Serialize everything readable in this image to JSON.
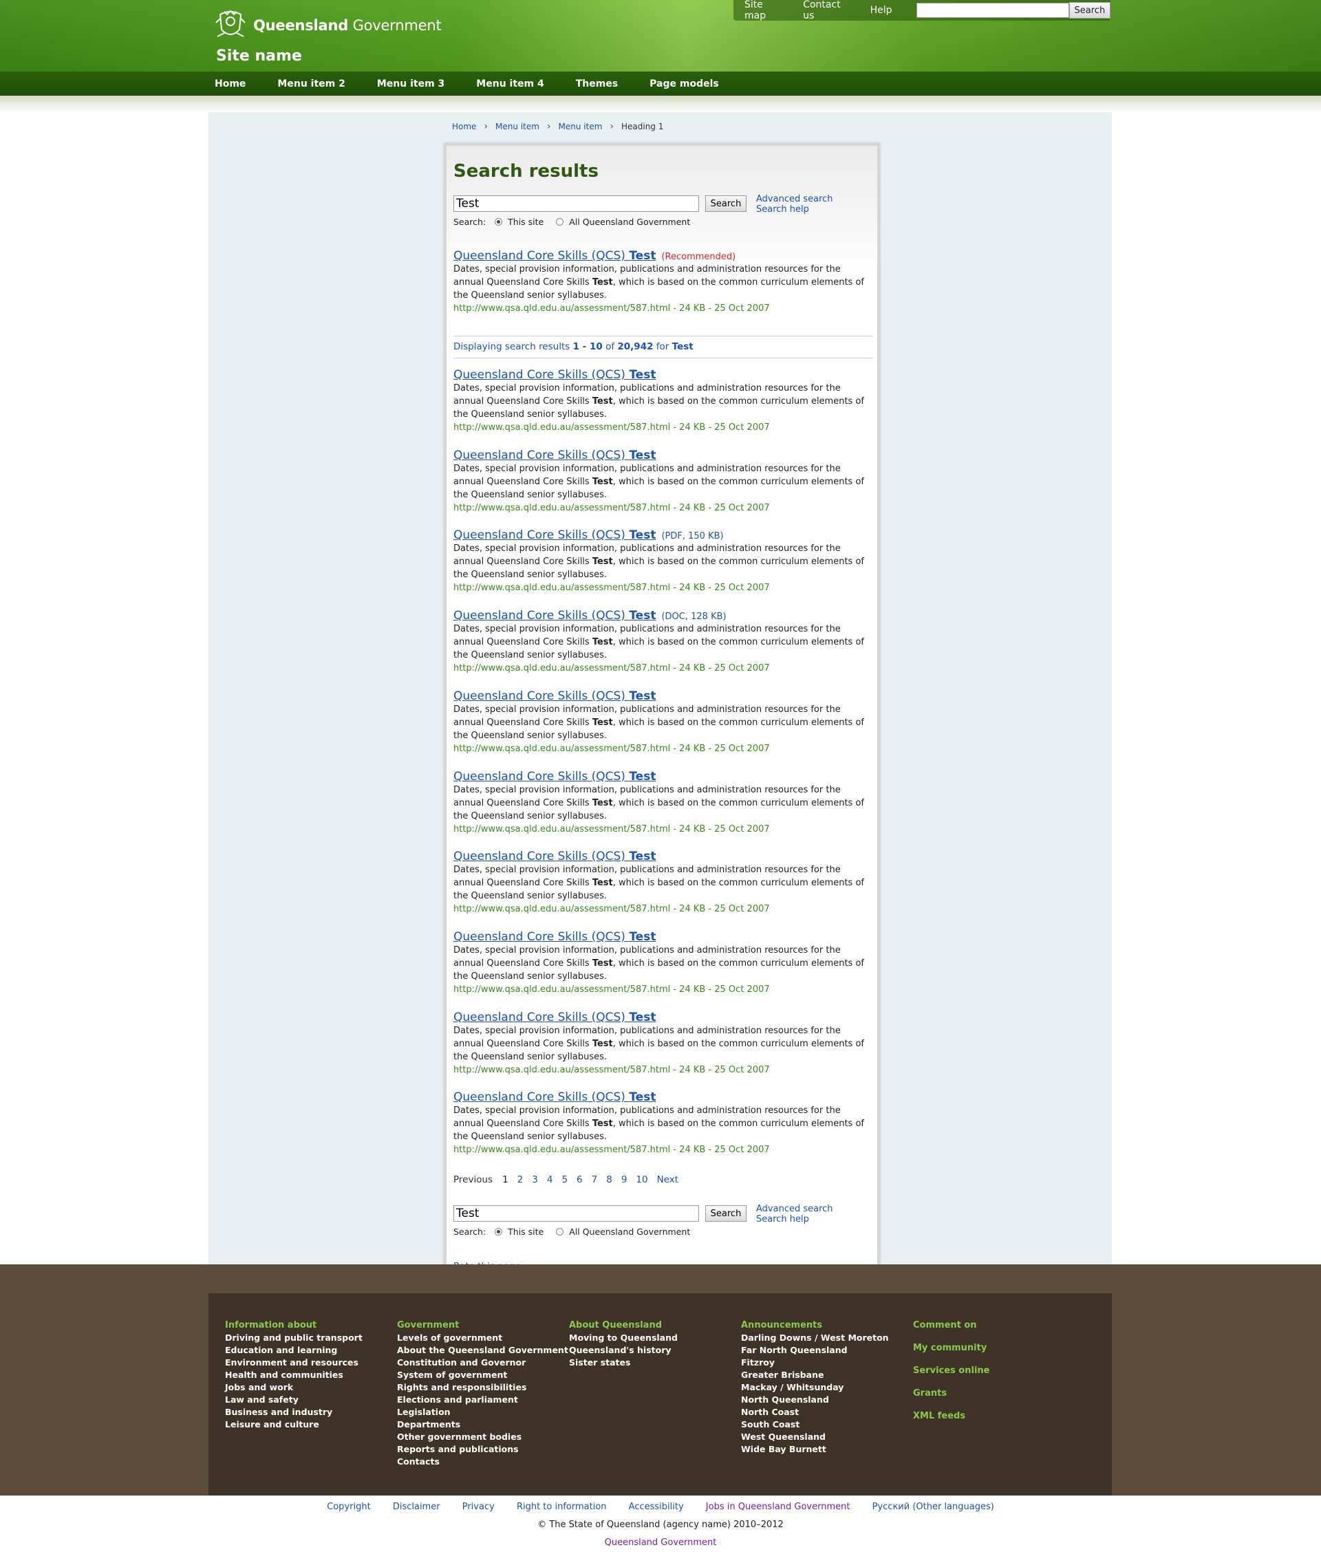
{
  "header": {
    "brand_bold": "Queensland",
    "brand_rest": " Government",
    "site_name": "Site name",
    "utility_links": [
      "Site map",
      "Contact us",
      "Help"
    ],
    "search_button": "Search",
    "search_value": ""
  },
  "nav": [
    "Home",
    "Menu item 2",
    "Menu item 3",
    "Menu item 4",
    "Themes",
    "Page models"
  ],
  "breadcrumb": [
    "Home",
    "Menu item",
    "Menu item",
    "Heading 1"
  ],
  "main": {
    "title": "Search results",
    "search": {
      "value": "Test",
      "button": "Search",
      "advanced": "Advanced search",
      "help": "Search help",
      "scope_label": "Search:",
      "scope_options": [
        "This site",
        "All Queensland Government"
      ],
      "selected_scope": "This site"
    },
    "recommended": {
      "title": "Queensland Core Skills (QCS) ",
      "title_bold": "Test",
      "tag": "(Recommended)",
      "desc_1": "Dates, special provision information, publications and administration resources for the annual Queensland Core Skills ",
      "desc_bold": "Test",
      "desc_2": ", which is based on the common curriculum elements of the Queensland senior syllabuses.",
      "url": "http://www.qsa.qld.edu.au/assessment/587.html - 24 KB - 25 Oct 2007"
    },
    "display_line": {
      "prefix": "Displaying search results ",
      "range": "1 - 10",
      "of": " of ",
      "total": "20,942",
      "for": " for ",
      "query": "Test"
    },
    "results": [
      {
        "title": "Queensland Core Skills (QCS) ",
        "title_bold": "Test",
        "tag": "",
        "desc_1": "Dates, special provision information, publications and administration resources for the annual Queensland Core Skills ",
        "desc_bold": "Test",
        "desc_2": ", which is based on the common curriculum elements of the Queensland senior syllabuses.",
        "url": "http://www.qsa.qld.edu.au/assessment/587.html - 24 KB - 25 Oct 2007"
      },
      {
        "title": "Queensland Core Skills (QCS) ",
        "title_bold": "Test",
        "tag": "",
        "desc_1": "Dates, special provision information, publications and administration resources for the annual Queensland Core Skills ",
        "desc_bold": "Test",
        "desc_2": ", which is based on the common curriculum elements of the Queensland senior syllabuses.",
        "url": "http://www.qsa.qld.edu.au/assessment/587.html - 24 KB - 25 Oct 2007"
      },
      {
        "title": "Queensland Core Skills (QCS) ",
        "title_bold": "Test",
        "tag": "(PDF, 150 KB)",
        "desc_1": "Dates, special provision information, publications and administration resources for the annual Queensland Core Skills ",
        "desc_bold": "Test",
        "desc_2": ", which is based on the common curriculum elements of the Queensland senior syllabuses.",
        "url": "http://www.qsa.qld.edu.au/assessment/587.html - 24 KB - 25 Oct 2007"
      },
      {
        "title": "Queensland Core Skills (QCS) ",
        "title_bold": "Test",
        "tag": "(DOC, 128 KB)",
        "desc_1": "Dates, special provision information, publications and administration resources for the annual Queensland Core Skills ",
        "desc_bold": "Test",
        "desc_2": ", which is based on the common curriculum elements of the Queensland senior syllabuses.",
        "url": "http://www.qsa.qld.edu.au/assessment/587.html - 24 KB - 25 Oct 2007"
      },
      {
        "title": "Queensland Core Skills (QCS) ",
        "title_bold": "Test",
        "tag": "",
        "desc_1": "Dates, special provision information, publications and administration resources for the annual Queensland Core Skills ",
        "desc_bold": "Test",
        "desc_2": ", which is based on the common curriculum elements of the Queensland senior syllabuses.",
        "url": "http://www.qsa.qld.edu.au/assessment/587.html - 24 KB - 25 Oct 2007"
      },
      {
        "title": "Queensland Core Skills (QCS) ",
        "title_bold": "Test",
        "tag": "",
        "desc_1": "Dates, special provision information, publications and administration resources for the annual Queensland Core Skills ",
        "desc_bold": "Test",
        "desc_2": ", which is based on the common curriculum elements of the Queensland senior syllabuses.",
        "url": "http://www.qsa.qld.edu.au/assessment/587.html - 24 KB - 25 Oct 2007"
      },
      {
        "title": "Queensland Core Skills (QCS) ",
        "title_bold": "Test",
        "tag": "",
        "desc_1": "Dates, special provision information, publications and administration resources for the annual Queensland Core Skills ",
        "desc_bold": "Test",
        "desc_2": ", which is based on the common curriculum elements of the Queensland senior syllabuses.",
        "url": "http://www.qsa.qld.edu.au/assessment/587.html - 24 KB - 25 Oct 2007"
      },
      {
        "title": "Queensland Core Skills (QCS) ",
        "title_bold": "Test",
        "tag": "",
        "desc_1": "Dates, special provision information, publications and administration resources for the annual Queensland Core Skills ",
        "desc_bold": "Test",
        "desc_2": ", which is based on the common curriculum elements of the Queensland senior syllabuses.",
        "url": "http://www.qsa.qld.edu.au/assessment/587.html - 24 KB - 25 Oct 2007"
      },
      {
        "title": "Queensland Core Skills (QCS) ",
        "title_bold": "Test",
        "tag": "",
        "desc_1": "Dates, special provision information, publications and administration resources for the annual Queensland Core Skills ",
        "desc_bold": "Test",
        "desc_2": ", which is based on the common curriculum elements of the Queensland senior syllabuses.",
        "url": "http://www.qsa.qld.edu.au/assessment/587.html - 24 KB - 25 Oct 2007"
      },
      {
        "title": "Queensland Core Skills (QCS) ",
        "title_bold": "Test",
        "tag": "",
        "desc_1": "Dates, special provision information, publications and administration resources for the annual Queensland Core Skills ",
        "desc_bold": "Test",
        "desc_2": ", which is based on the common curriculum elements of the Queensland senior syllabuses.",
        "url": "http://www.qsa.qld.edu.au/assessment/587.html - 24 KB - 25 Oct 2007"
      }
    ],
    "pager": {
      "previous": "Previous",
      "current": "1",
      "pages": [
        "2",
        "3",
        "4",
        "5",
        "6",
        "7",
        "8",
        "9",
        "10"
      ],
      "next": "Next"
    },
    "rate_link": "Rate this page"
  },
  "footer": {
    "columns": [
      {
        "heading": "Information about",
        "items": [
          "Driving and public transport",
          "Education and learning",
          "Environment and resources",
          "Health and communities",
          "Jobs and work",
          "Law and safety",
          "Business and industry",
          "Leisure and culture"
        ]
      },
      {
        "heading": "Government",
        "items": [
          "Levels of government",
          "About the Queensland Government",
          "Constitution and Governor",
          "System of government",
          "Rights and responsibilities",
          "Elections and parliament",
          "Legislation",
          "Departments",
          "Other government bodies",
          "Reports and publications",
          "Contacts"
        ]
      },
      {
        "heading": "About Queensland",
        "items": [
          "Moving to Queensland",
          "Queensland's history",
          "Sister states"
        ]
      },
      {
        "heading": "Announcements",
        "items": [
          "Darling Downs / West Moreton",
          "Far North Queensland",
          "Fitzroy",
          "Greater Brisbane",
          "Mackay / Whitsunday",
          "North Queensland",
          "North Coast",
          "South Coast",
          "West Queensland",
          "Wide Bay Burnett"
        ]
      },
      {
        "heading": "Comment on",
        "items": [
          "My community",
          "Services online",
          "Grants",
          "XML feeds"
        ]
      }
    ],
    "bottom_links": [
      "Copyright",
      "Disclaimer",
      "Privacy",
      "Right to information",
      "Accessibility",
      "Jobs in Queensland Government",
      "Русский (Other languages)"
    ],
    "copyright": "© The State of Queensland (agency name) 2010–2012",
    "qgov_link": "Queensland Government"
  }
}
